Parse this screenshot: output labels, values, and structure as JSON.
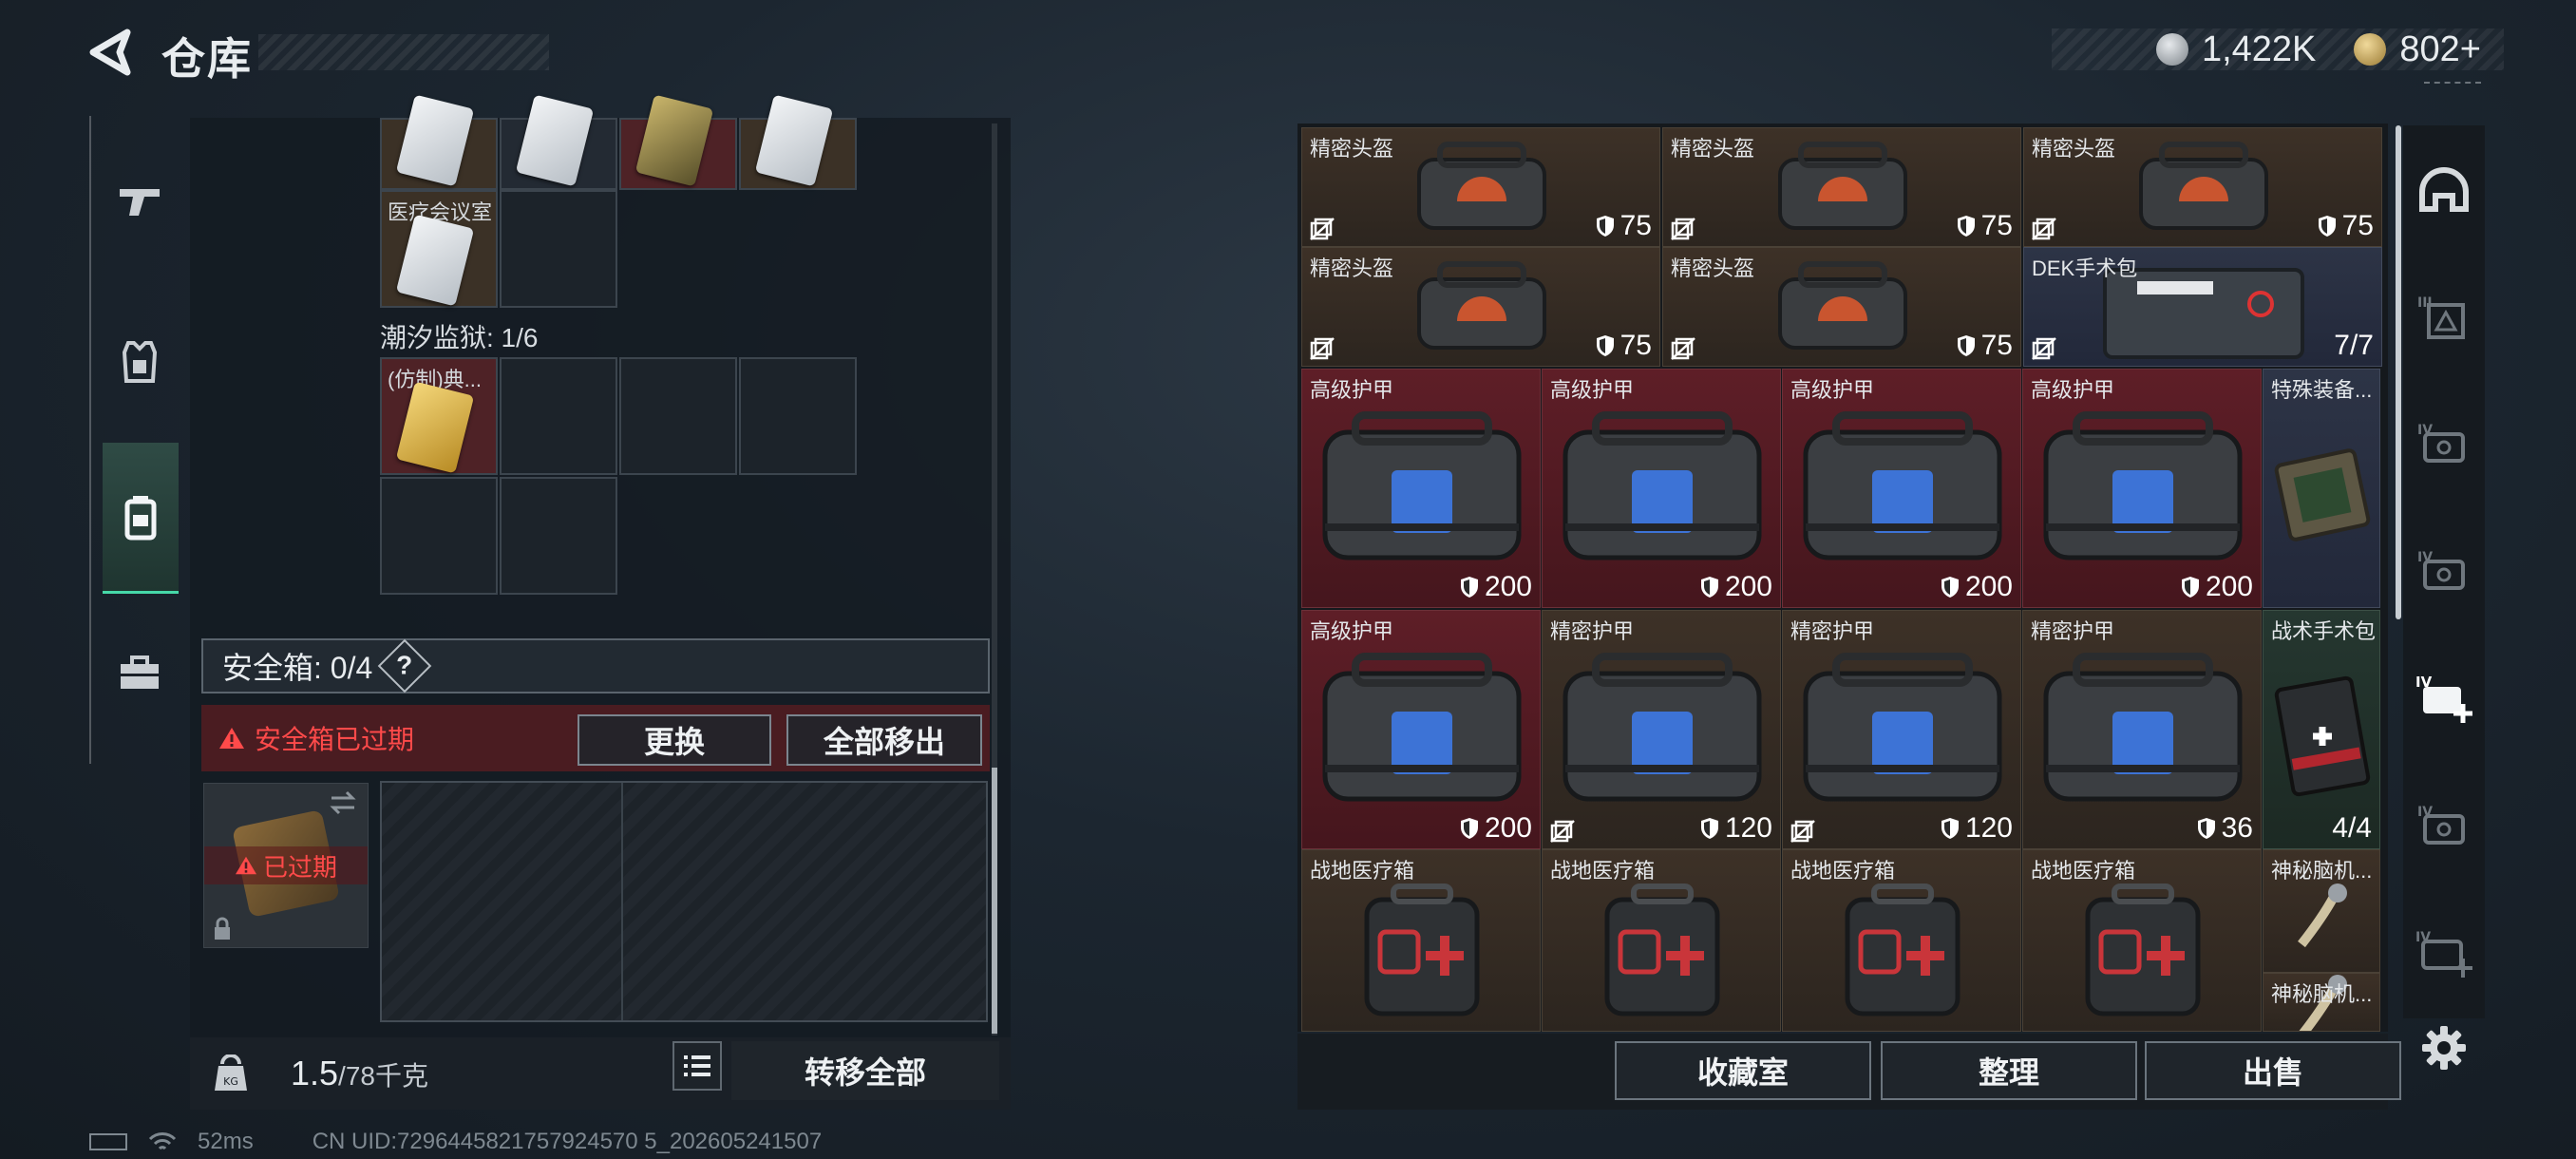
{
  "header": {
    "back_icon": "back-arrow-icon",
    "title": "仓库",
    "currency_silver": "1,422K",
    "currency_gold": "802+"
  },
  "left_tabs": [
    {
      "icon": "gun-icon",
      "active": false
    },
    {
      "icon": "armor-vest-icon",
      "active": false
    },
    {
      "icon": "backpack-icon",
      "active": true
    },
    {
      "icon": "toolbox-icon",
      "active": false
    }
  ],
  "storage": {
    "room_label": "医疗会议室",
    "section_label": "潮汐监狱: 1/6",
    "item_label": "(仿制)典..."
  },
  "safebox": {
    "label": "安全箱: 0/4",
    "help": "?",
    "expired_warning": "安全箱已过期",
    "replace_button": "更换",
    "move_all_out_button": "全部移出",
    "expired_badge": "已过期"
  },
  "bottom_left": {
    "weight_value": "1.5",
    "weight_max": "/78千克",
    "transfer_all": "转移全部"
  },
  "inventory": {
    "items": [
      {
        "name": "精密头盔",
        "durability": "75",
        "locked": true,
        "color": "brown",
        "kind": "helmet-bag"
      },
      {
        "name": "精密头盔",
        "durability": "75",
        "locked": true,
        "color": "brown",
        "kind": "helmet-bag"
      },
      {
        "name": "精密头盔",
        "durability": "75",
        "locked": true,
        "color": "brown",
        "kind": "helmet-bag"
      },
      {
        "name": "精密头盔",
        "durability": "75",
        "locked": true,
        "color": "brown",
        "kind": "helmet-bag"
      },
      {
        "name": "精密头盔",
        "durability": "75",
        "locked": true,
        "color": "brown",
        "kind": "helmet-bag"
      },
      {
        "name": "DEK手术包",
        "count": "7/7",
        "locked": true,
        "color": "navy",
        "kind": "surgery-kit"
      },
      {
        "name": "高级护甲",
        "durability": "200",
        "locked": false,
        "color": "red",
        "kind": "blue-armor-bag"
      },
      {
        "name": "高级护甲",
        "durability": "200",
        "locked": false,
        "color": "red",
        "kind": "blue-armor-bag"
      },
      {
        "name": "高级护甲",
        "durability": "200",
        "locked": false,
        "color": "red",
        "kind": "blue-armor-bag"
      },
      {
        "name": "高级护甲",
        "durability": "200",
        "locked": false,
        "color": "red",
        "kind": "blue-armor-bag"
      },
      {
        "name": "特殊装备...",
        "locked": false,
        "color": "navy",
        "kind": "case"
      },
      {
        "name": "高级护甲",
        "durability": "200",
        "locked": false,
        "color": "red",
        "kind": "blue-armor-bag"
      },
      {
        "name": "精密护甲",
        "durability": "120",
        "locked": true,
        "color": "brown",
        "kind": "blue-armor-bag"
      },
      {
        "name": "精密护甲",
        "durability": "120",
        "locked": true,
        "color": "brown",
        "kind": "blue-armor-bag"
      },
      {
        "name": "精密护甲",
        "durability": "36",
        "locked": false,
        "color": "brown",
        "kind": "blue-armor-bag"
      },
      {
        "name": "战术手术包",
        "count": "4/4",
        "locked": false,
        "color": "green",
        "kind": "tactical-kit"
      },
      {
        "name": "战地医疗箱",
        "color": "brown",
        "kind": "medkit"
      },
      {
        "name": "战地医疗箱",
        "color": "brown",
        "kind": "medkit"
      },
      {
        "name": "战地医疗箱",
        "color": "brown",
        "kind": "medkit"
      },
      {
        "name": "战地医疗箱",
        "color": "brown",
        "kind": "medkit"
      },
      {
        "name": "神秘脑机...",
        "color": "brown",
        "kind": "brain-chip"
      },
      {
        "name": "神秘脑机...",
        "color": "brown",
        "kind": "brain-chip"
      }
    ]
  },
  "bottom_right": {
    "collection_room": "收藏室",
    "organize": "整理",
    "sell": "出售"
  },
  "right_sidebar": [
    "helmet-tab-icon",
    "armor-iii-tab-icon",
    "bag-iv-tab-icon",
    "bag-iv-tab-icon",
    "bag-iv-add-icon",
    "bag-iv-tab-icon",
    "bag-iv-add-icon",
    "settings-gear-icon"
  ],
  "status_bar": {
    "ping": "52ms",
    "uid": "CN UID:7296445821757924570 5_202605241507"
  },
  "colors": {
    "accent_green": "#46d8a8",
    "warning_red": "#ff4a4a",
    "tile_brown": "#3d3127",
    "tile_red": "#5e1e27",
    "tile_navy": "#2d3446"
  }
}
